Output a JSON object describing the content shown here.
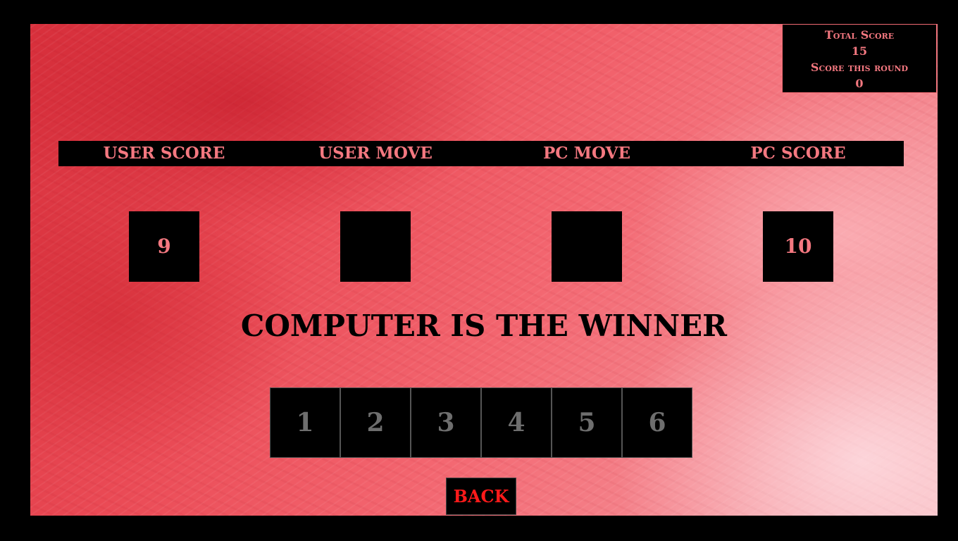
{
  "score_panel": {
    "total_score_label": "Total Score",
    "total_score_value": "15",
    "round_score_label": "Score this round",
    "round_score_value": "0"
  },
  "headers": {
    "user_score": "USER SCORE",
    "user_move": "USER MOVE",
    "pc_move": "PC MOVE",
    "pc_score": "PC SCORE"
  },
  "values": {
    "user_score": "9",
    "user_move": "",
    "pc_move": "",
    "pc_score": "10"
  },
  "result_message": "COMPUTER IS THE WINNER",
  "move_buttons": [
    "1",
    "2",
    "3",
    "4",
    "5",
    "6"
  ],
  "back_label": "BACK",
  "colors": {
    "accent": "#f47880",
    "back_text": "#ff1a1a",
    "button_text": "#6e6e6e",
    "panel_bg": "#000000"
  }
}
